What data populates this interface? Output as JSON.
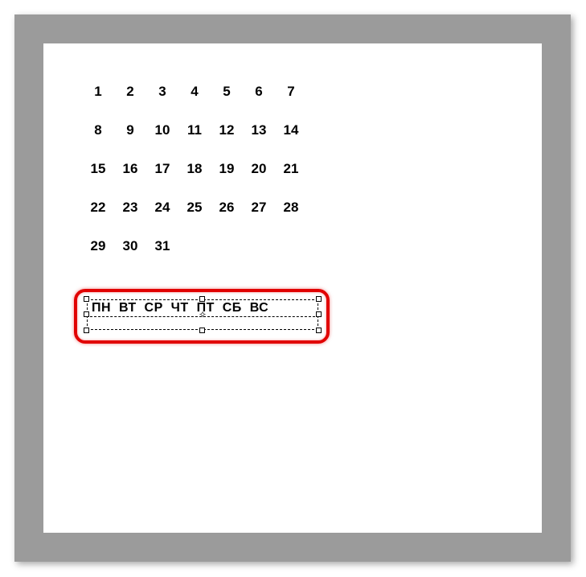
{
  "calendar": {
    "rows": [
      [
        "1",
        "2",
        "3",
        "4",
        "5",
        "6",
        "7"
      ],
      [
        "8",
        "9",
        "10",
        "11",
        "12",
        "13",
        "14"
      ],
      [
        "15",
        "16",
        "17",
        "18",
        "19",
        "20",
        "21"
      ],
      [
        "22",
        "23",
        "24",
        "25",
        "26",
        "27",
        "28"
      ],
      [
        "29",
        "30",
        "31"
      ]
    ]
  },
  "weekdays_text": "ПН  ВТ  СР  ЧТ  ПТ  СБ  ВС"
}
